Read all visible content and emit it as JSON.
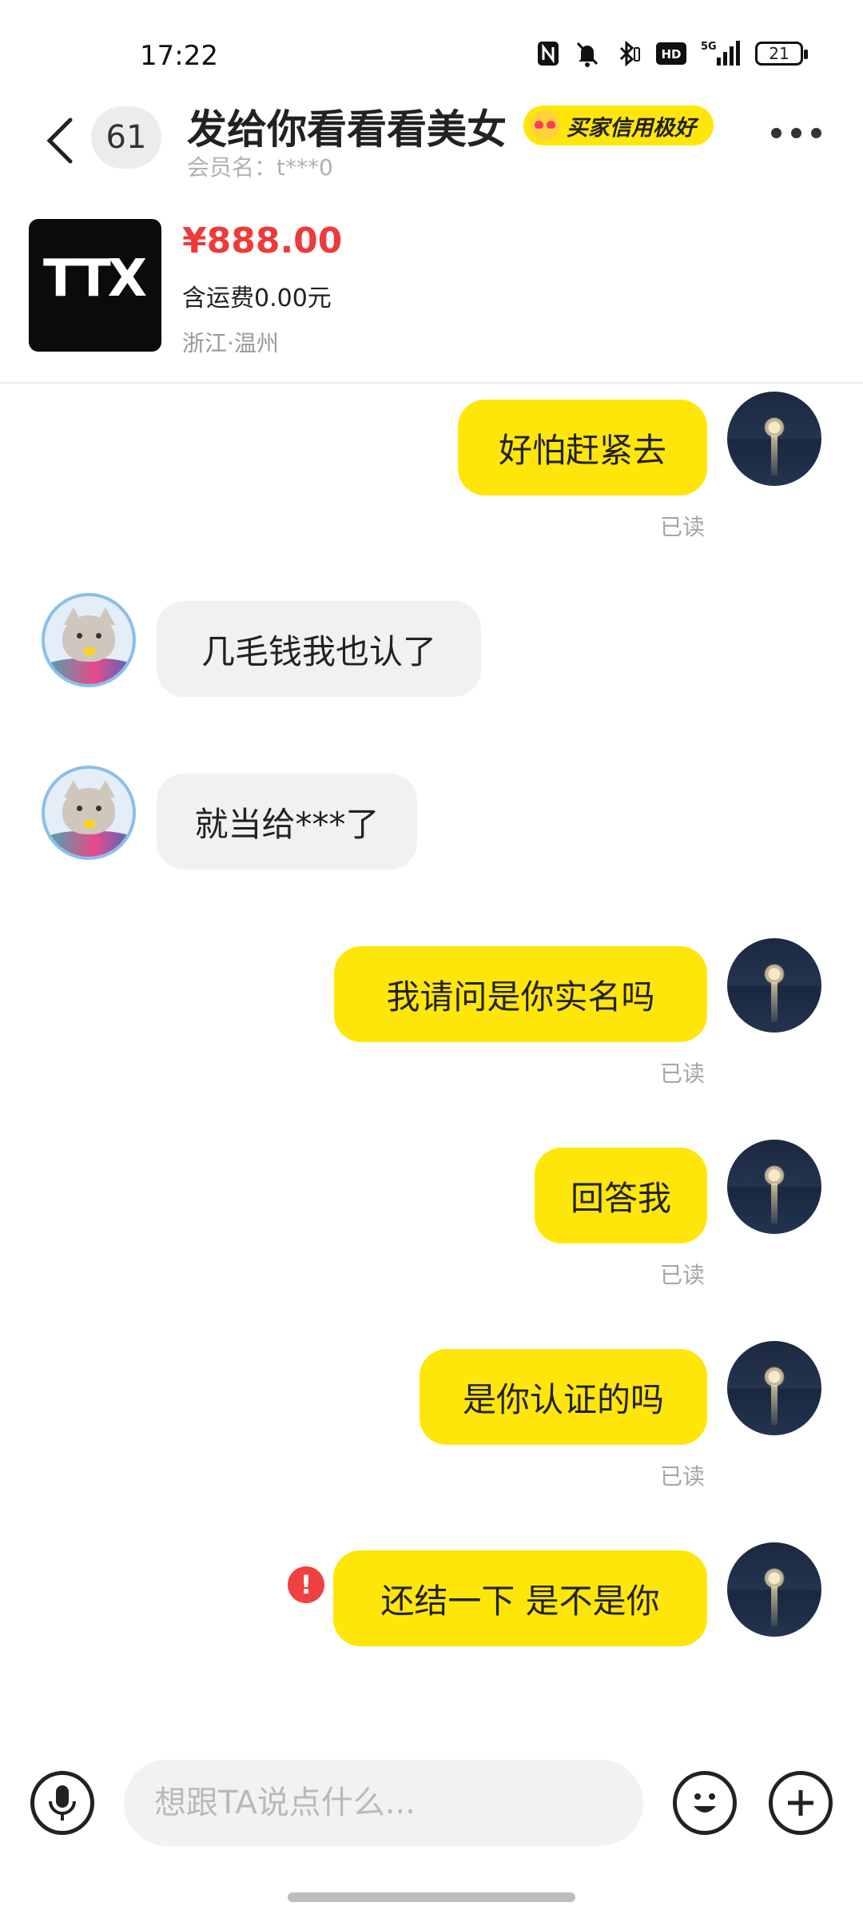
{
  "status_bar": {
    "time": "17:22",
    "network": "5G",
    "hd": "HD",
    "battery": "21",
    "icons": [
      "nfc-icon",
      "mute-icon",
      "bluetooth-icon",
      "hd-icon",
      "signal-icon",
      "battery-icon"
    ]
  },
  "header": {
    "unread_count": "61",
    "title": "发给你看看看美女",
    "credit_badge": "买家信用极好",
    "member_label": "会员名：t***0"
  },
  "product": {
    "logo": "TTX",
    "price": "¥888.00",
    "shipping": "含运费0.00元",
    "location": "浙江·温州"
  },
  "messages": [
    {
      "from": "me",
      "text": "好怕赶紧去",
      "status": "已读"
    },
    {
      "from": "them",
      "text": "几毛钱我也认了"
    },
    {
      "from": "them",
      "text": "就当给***了"
    },
    {
      "from": "me",
      "text": "我请问是你实名吗",
      "status": "已读"
    },
    {
      "from": "me",
      "text": "回答我",
      "status": "已读"
    },
    {
      "from": "me",
      "text": "是你认证的吗",
      "status": "已读"
    },
    {
      "from": "me",
      "text": "还结一下 是不是你",
      "status": "failed"
    }
  ],
  "input": {
    "placeholder": "想跟TA说点什么..."
  },
  "colors": {
    "accent": "#ffe60a",
    "price": "#ee3a3a",
    "error": "#f04040"
  }
}
